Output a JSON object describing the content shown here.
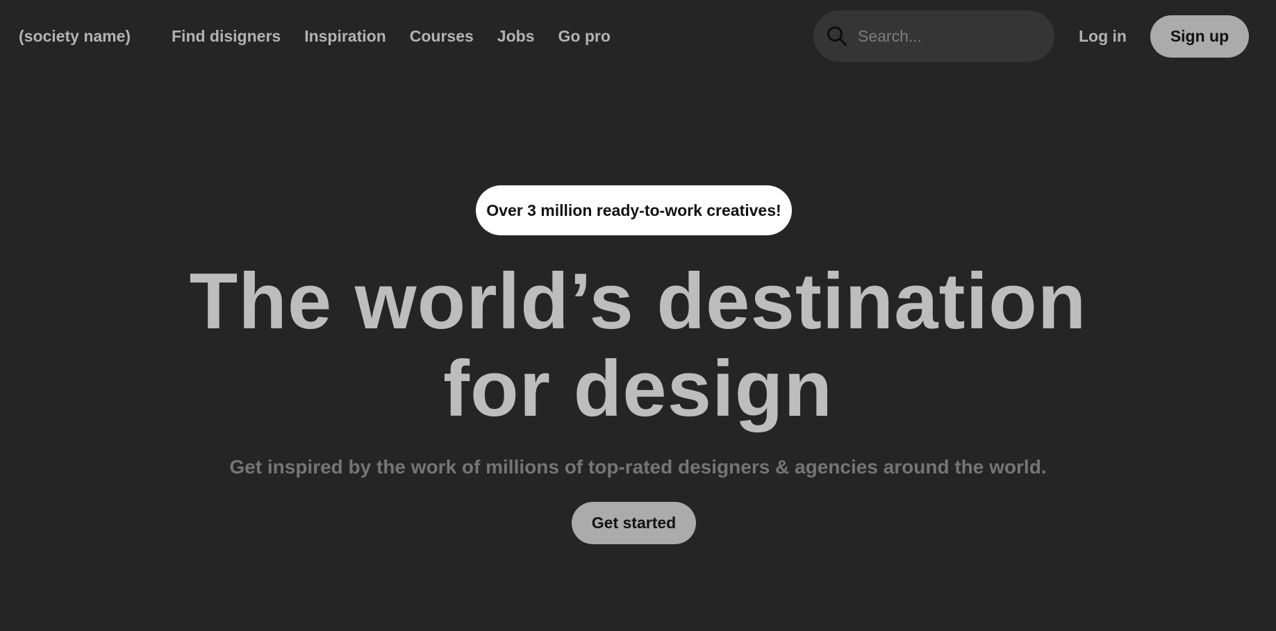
{
  "header": {
    "brand": "(society name)",
    "nav": [
      {
        "label": "Find disigners"
      },
      {
        "label": "Inspiration"
      },
      {
        "label": "Courses"
      },
      {
        "label": "Jobs"
      },
      {
        "label": "Go pro"
      }
    ],
    "search": {
      "placeholder": "Search...",
      "value": "",
      "icon": "search-icon"
    },
    "login_label": "Log in",
    "signup_label": "Sign up"
  },
  "hero": {
    "badge": "Over 3 million ready-to-work creatives!",
    "title_line1": "The world’s destination",
    "title_line2": "for design",
    "subtitle": "Get inspired by the work of millions of top-rated designers & agencies around the world.",
    "cta_label": "Get started"
  },
  "colors": {
    "background": "#262525",
    "search_bg": "#363535",
    "button_bg": "#ababab",
    "badge_bg": "#ffffff",
    "nav_text": "#b3b3b3",
    "title_text": "#bdbdbd",
    "subtitle_text": "#757575"
  }
}
